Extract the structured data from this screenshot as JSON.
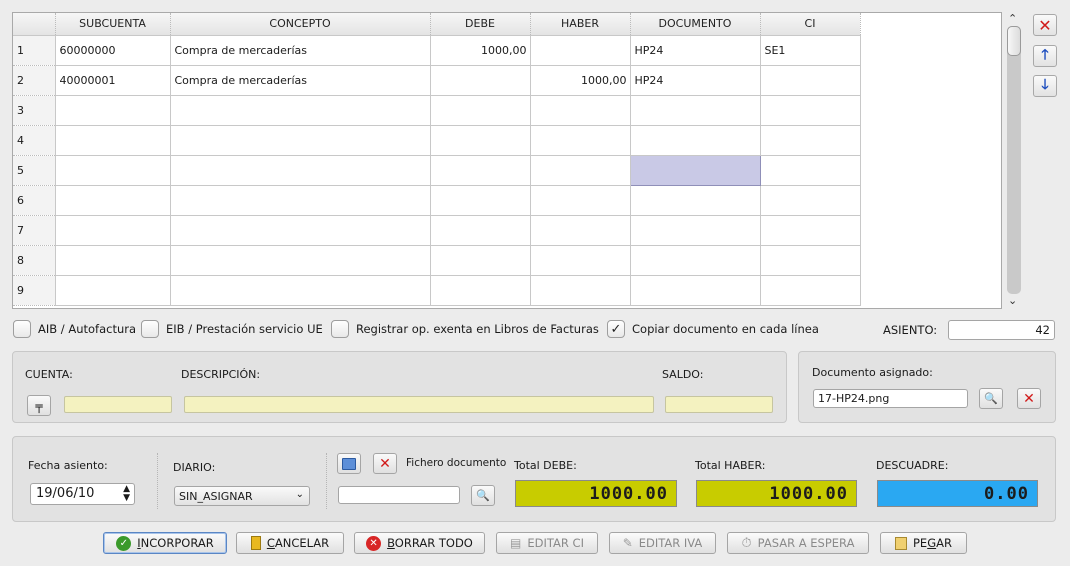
{
  "grid": {
    "columns": [
      "SUBCUENTA",
      "CONCEPTO",
      "DEBE",
      "HABER",
      "DOCUMENTO",
      "CI"
    ],
    "rows": [
      {
        "n": "1",
        "subcuenta": "60000000",
        "concepto": "Compra de mercaderías",
        "debe": "1000,00",
        "haber": "",
        "documento": "HP24",
        "ci": "SE1"
      },
      {
        "n": "2",
        "subcuenta": "40000001",
        "concepto": "Compra de mercaderías",
        "debe": "",
        "haber": "1000,00",
        "documento": "HP24",
        "ci": ""
      },
      {
        "n": "3",
        "subcuenta": "",
        "concepto": "",
        "debe": "",
        "haber": "",
        "documento": "",
        "ci": ""
      },
      {
        "n": "4",
        "subcuenta": "",
        "concepto": "",
        "debe": "",
        "haber": "",
        "documento": "",
        "ci": ""
      },
      {
        "n": "5",
        "subcuenta": "",
        "concepto": "",
        "debe": "",
        "haber": "",
        "documento": "",
        "ci": ""
      },
      {
        "n": "6",
        "subcuenta": "",
        "concepto": "",
        "debe": "",
        "haber": "",
        "documento": "",
        "ci": ""
      },
      {
        "n": "7",
        "subcuenta": "",
        "concepto": "",
        "debe": "",
        "haber": "",
        "documento": "",
        "ci": ""
      },
      {
        "n": "8",
        "subcuenta": "",
        "concepto": "",
        "debe": "",
        "haber": "",
        "documento": "",
        "ci": ""
      },
      {
        "n": "9",
        "subcuenta": "",
        "concepto": "",
        "debe": "",
        "haber": "",
        "documento": "",
        "ci": ""
      }
    ]
  },
  "options": {
    "aib": "AIB / Autofactura",
    "eib": "EIB / Prestación servicio UE",
    "registrar": "Registrar op. exenta en Libros de Facturas",
    "copiar": "Copiar documento en cada línea",
    "copiar_checked": "✓"
  },
  "asiento": {
    "label": "ASIENTO:",
    "value": "42"
  },
  "cuenta_panel": {
    "cuenta_label": "CUENTA:",
    "descripcion_label": "DESCRIPCIÓN:",
    "saldo_label": "SALDO:"
  },
  "documento_panel": {
    "label": "Documento asignado:",
    "value": "17-HP24.png"
  },
  "footer": {
    "fecha_label": "Fecha asiento:",
    "fecha_value": "19/06/10",
    "diario_label": "DIARIO:",
    "diario_value": "SIN_ASIGNAR",
    "fichero_label": "Fichero documento",
    "total_debe_label": "Total DEBE:",
    "total_debe_value": "1000.00",
    "total_haber_label": "Total HABER:",
    "total_haber_value": "1000.00",
    "descuadre_label": "DESCUADRE:",
    "descuadre_value": "0.00"
  },
  "colors": {
    "lcd_yellow": "#c8cc00",
    "lcd_blue": "#2aa8f2",
    "cell_selected": "#c9c9e6",
    "field_yellow": "#f4f2c0"
  },
  "buttons": {
    "incorporar": {
      "u": "I",
      "rest": "NCORPORAR"
    },
    "cancelar": {
      "u": "C",
      "rest": "ANCELAR"
    },
    "borrar": {
      "u": "B",
      "rest": "ORRAR TODO"
    },
    "editar_ci": "EDITAR CI",
    "editar_iva": "EDITAR IVA",
    "pasar": "PASAR A ESPERA",
    "pegar": {
      "pre": "PE",
      "u": "G",
      "rest": "AR"
    }
  }
}
